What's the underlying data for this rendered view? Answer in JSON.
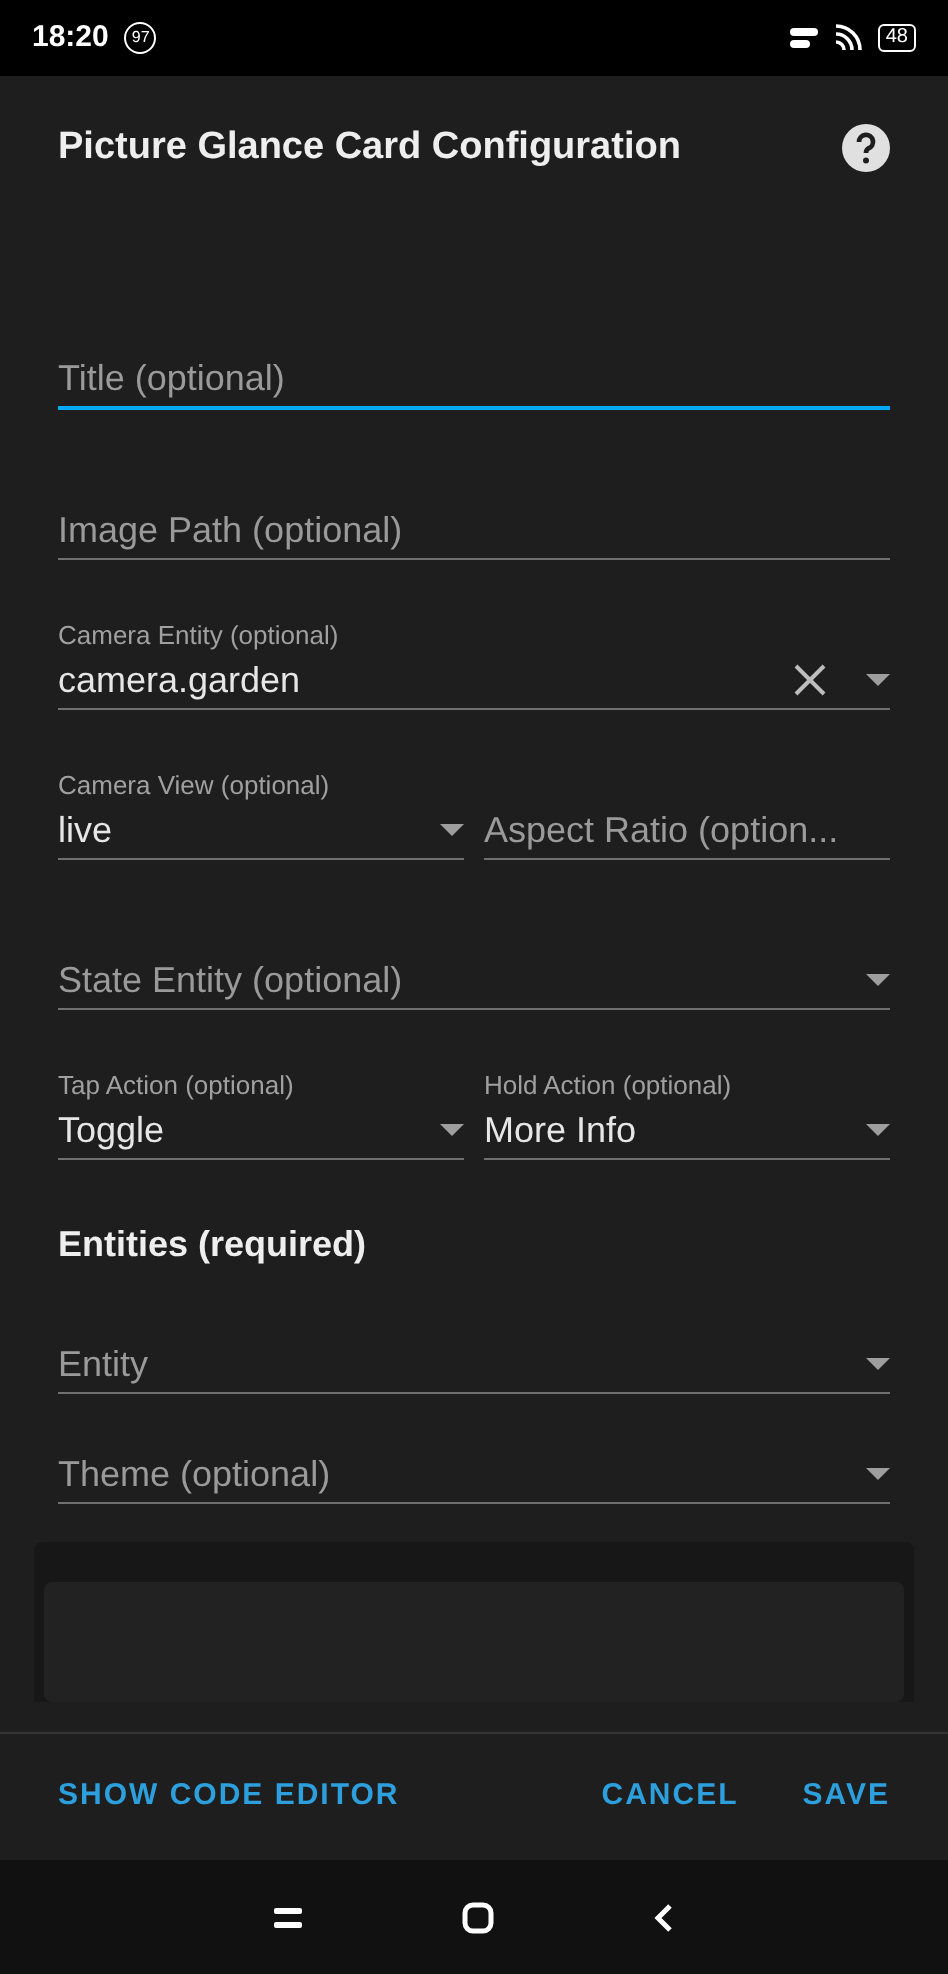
{
  "status_bar": {
    "time": "18:20",
    "badge": "97",
    "battery": "48"
  },
  "dialog": {
    "title": "Picture Glance Card Configuration"
  },
  "rows": [
    [
      {
        "placeholder": "Title (optional)",
        "focused": true,
        "dropdown": false,
        "clearable": false
      }
    ],
    [
      {
        "placeholder": "Image Path (optional)",
        "focused": false,
        "dropdown": false,
        "clearable": false
      }
    ],
    [
      {
        "label": "Camera Entity (optional)",
        "value": "camera.garden",
        "focused": false,
        "dropdown": true,
        "clearable": true
      }
    ],
    [
      {
        "label": "Camera View (optional)",
        "value": "live",
        "focused": false,
        "dropdown": true,
        "clearable": false
      },
      {
        "placeholder": "Aspect Ratio (option...",
        "focused": false,
        "dropdown": false,
        "clearable": false
      }
    ],
    [
      {
        "placeholder": "State Entity (optional)",
        "focused": false,
        "dropdown": true,
        "clearable": false
      }
    ],
    [
      {
        "label": "Tap Action (optional)",
        "value": "Toggle",
        "focused": false,
        "dropdown": true,
        "clearable": false
      },
      {
        "label": "Hold Action (optional)",
        "value": "More Info",
        "focused": false,
        "dropdown": true,
        "clearable": false
      }
    ]
  ],
  "entities": {
    "heading": "Entities (required)",
    "fields": [
      {
        "placeholder": "Entity",
        "focused": false,
        "dropdown": true,
        "clearable": false
      },
      {
        "placeholder": "Theme (optional)",
        "focused": false,
        "dropdown": true,
        "clearable": false
      }
    ]
  },
  "footer": {
    "left": "SHOW CODE EDITOR",
    "buttons": [
      "CANCEL",
      "SAVE"
    ]
  }
}
